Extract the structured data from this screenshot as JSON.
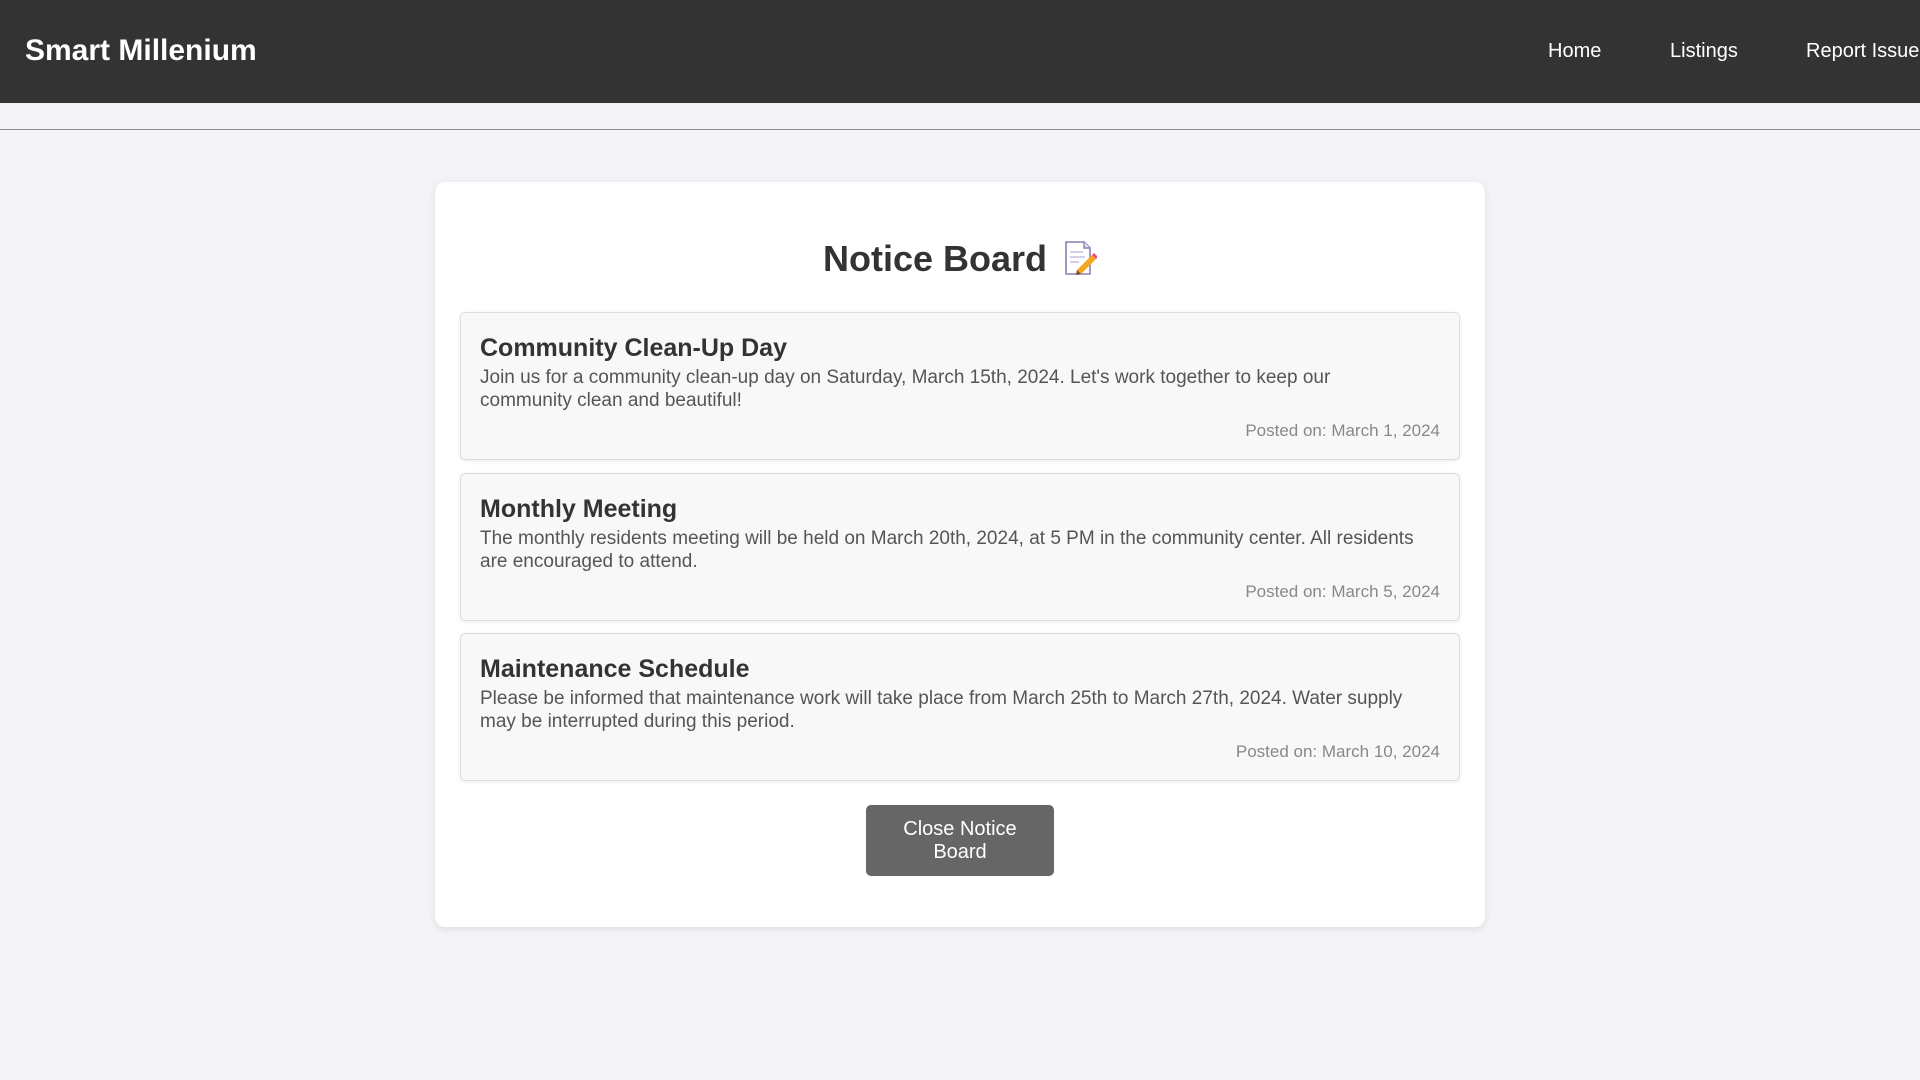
{
  "header": {
    "brand": "Smart Millenium",
    "nav": [
      {
        "label": "Home"
      },
      {
        "label": "Listings"
      },
      {
        "label": "Report Issue"
      }
    ]
  },
  "notice_board": {
    "title": "Notice Board",
    "title_icon": "memo-icon",
    "notices": [
      {
        "title": "Community Clean-Up Day",
        "body": "Join us for a community clean-up day on Saturday, March 15th, 2024. Let's work together to keep our community clean and beautiful!",
        "date": "Posted on: March 1, 2024"
      },
      {
        "title": "Monthly Meeting",
        "body": "The monthly residents meeting will be held on March 20th, 2024, at 5 PM in the community center. All residents are encouraged to attend.",
        "date": "Posted on: March 5, 2024"
      },
      {
        "title": "Maintenance Schedule",
        "body": "Please be informed that maintenance work will take place from March 25th to March 27th, 2024. Water supply may be interrupted during this period.",
        "date": "Posted on: March 10, 2024"
      }
    ],
    "close_label": "Close Notice Board"
  },
  "colors": {
    "navbar": "#333333",
    "page_background": "#f4f4f8",
    "button": "#666666"
  }
}
